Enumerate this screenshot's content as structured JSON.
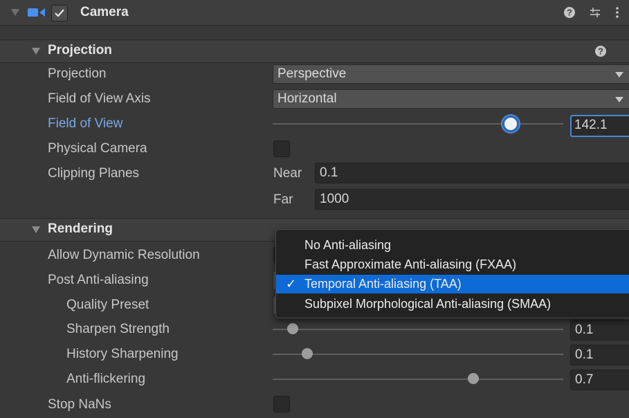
{
  "header": {
    "title": "Camera",
    "enabled": true,
    "icons": [
      "help-icon",
      "presets-icon",
      "more-menu-icon"
    ]
  },
  "projection_section": {
    "title": "Projection",
    "rows": {
      "projection": {
        "label": "Projection",
        "value": "Perspective"
      },
      "fov_axis": {
        "label": "Field of View Axis",
        "value": "Horizontal"
      },
      "fov": {
        "label": "Field of View",
        "value": "142.1",
        "slider_fraction": 0.82
      },
      "physical_camera": {
        "label": "Physical Camera",
        "checked": false
      },
      "clipping": {
        "label": "Clipping Planes",
        "near_label": "Near",
        "near_value": "0.1",
        "far_label": "Far",
        "far_value": "1000"
      }
    }
  },
  "rendering_section": {
    "title": "Rendering",
    "rows": {
      "dynamic_resolution": {
        "label": "Allow Dynamic Resolution"
      },
      "post_aa": {
        "label": "Post Anti-aliasing"
      },
      "quality_preset": {
        "label": "Quality Preset"
      },
      "sharpen_strength": {
        "label": "Sharpen Strength",
        "value": "0.1",
        "slider_fraction": 0.07
      },
      "history_sharpening": {
        "label": "History Sharpening",
        "value": "0.1",
        "slider_fraction": 0.12
      },
      "anti_flickering": {
        "label": "Anti-flickering",
        "value": "0.7",
        "slider_fraction": 0.69
      },
      "stop_nans": {
        "label": "Stop NaNs",
        "checked": false
      }
    }
  },
  "aa_menu": {
    "options": [
      {
        "label": "No Anti-aliasing",
        "selected": false
      },
      {
        "label": "Fast Approximate Anti-aliasing (FXAA)",
        "selected": false
      },
      {
        "label": "Temporal Anti-aliasing (TAA)",
        "selected": true
      },
      {
        "label": "Subpixel Morphological Anti-aliasing (SMAA)",
        "selected": false
      }
    ],
    "check_mark": "✓"
  },
  "colors": {
    "accent": "#0d6ad6",
    "focus_label": "#7aa7e6",
    "panel_bg": "#383838"
  }
}
